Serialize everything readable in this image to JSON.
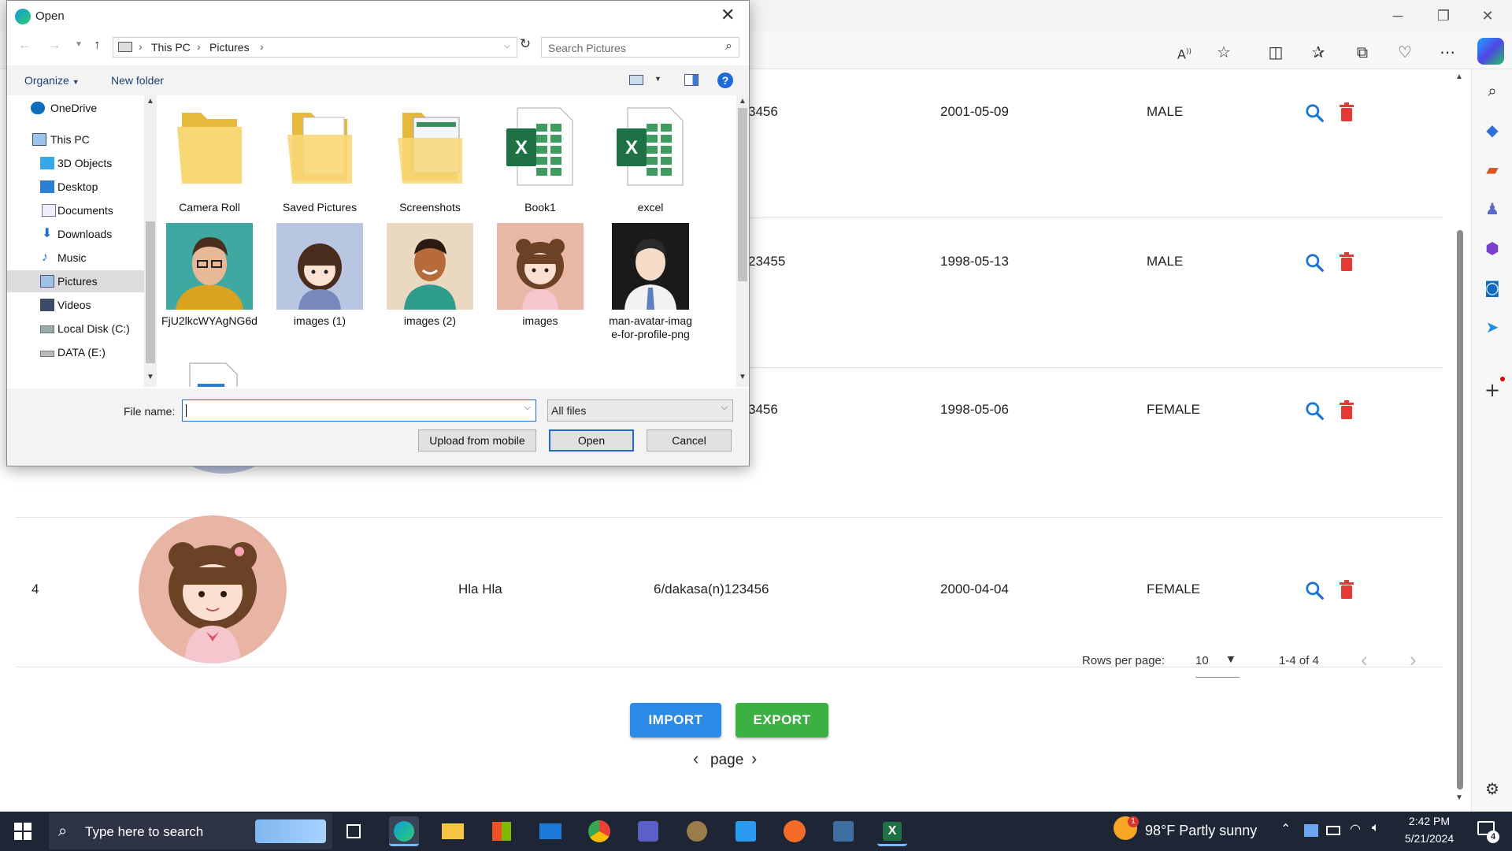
{
  "browser": {
    "window_controls": [
      "─",
      "❐",
      "✕"
    ],
    "toolbar_icons": [
      "read-aloud-icon",
      "favorite-star-icon",
      "split-screen-icon",
      "favorites-icon",
      "collections-icon",
      "browser-essentials-icon",
      "more-icon",
      "copilot-icon"
    ],
    "sidebar_icons": [
      "search-icon",
      "shopping-icon",
      "tools-icon",
      "games-icon",
      "microsoft365-icon",
      "outlook-icon",
      "drop-icon",
      "add-icon",
      "settings-icon"
    ]
  },
  "table": {
    "rows": [
      {
        "id": "",
        "name": "",
        "nrc": "3456",
        "dob": "2001-05-09",
        "gender": "MALE"
      },
      {
        "id": "",
        "name": "",
        "nrc": "23455",
        "dob": "1998-05-13",
        "gender": "MALE"
      },
      {
        "id": "",
        "name": "",
        "nrc": "3456",
        "dob": "1998-05-06",
        "gender": "FEMALE"
      },
      {
        "id": "4",
        "name": "Hla Hla",
        "nrc": "6/dakasa(n)123456",
        "dob": "2000-04-04",
        "gender": "FEMALE"
      }
    ],
    "rows_per_page_label": "Rows per page:",
    "rows_per_page_value": "10",
    "range_label": "1-4 of 4"
  },
  "actions": {
    "import_label": "IMPORT",
    "export_label": "EXPORT",
    "page_label": "page"
  },
  "dialog": {
    "title": "Open",
    "breadcrumb": [
      "This PC",
      "Pictures"
    ],
    "search_placeholder": "Search Pictures",
    "organize_label": "Organize",
    "new_folder_label": "New folder",
    "nav_items": [
      {
        "label": "OneDrive",
        "icon": "cloud-icon"
      },
      {
        "label": "This PC",
        "icon": "pc-icon"
      },
      {
        "label": "3D Objects",
        "icon": "cube-icon"
      },
      {
        "label": "Desktop",
        "icon": "desktop-icon"
      },
      {
        "label": "Documents",
        "icon": "document-icon"
      },
      {
        "label": "Downloads",
        "icon": "download-icon"
      },
      {
        "label": "Music",
        "icon": "music-icon"
      },
      {
        "label": "Pictures",
        "icon": "pictures-icon",
        "selected": true
      },
      {
        "label": "Videos",
        "icon": "video-icon"
      },
      {
        "label": "Local Disk (C:)",
        "icon": "drive-icon"
      },
      {
        "label": "DATA (E:)",
        "icon": "drive-icon"
      }
    ],
    "files": [
      {
        "label": "Camera Roll",
        "type": "folder"
      },
      {
        "label": "Saved Pictures",
        "type": "folder"
      },
      {
        "label": "Screenshots",
        "type": "folder"
      },
      {
        "label": "Book1",
        "type": "excel"
      },
      {
        "label": "excel",
        "type": "excel"
      },
      {
        "label": "FjU2lkcWYAgNG6d",
        "type": "image"
      },
      {
        "label": "images (1)",
        "type": "image"
      },
      {
        "label": "images (2)",
        "type": "image"
      },
      {
        "label": "images",
        "type": "image"
      },
      {
        "label": "man-avatar-image-for-profile-png",
        "type": "image"
      }
    ],
    "file_name_label": "File name:",
    "file_name_value": "",
    "filter_value": "All files",
    "upload_label": "Upload from mobile",
    "open_label": "Open",
    "cancel_label": "Cancel"
  },
  "taskbar": {
    "search_placeholder": "Type here to search",
    "weather": "98°F  Partly sunny",
    "weather_badge": "1",
    "time": "2:42 PM",
    "date": "5/21/2024",
    "notification_count": "4"
  }
}
